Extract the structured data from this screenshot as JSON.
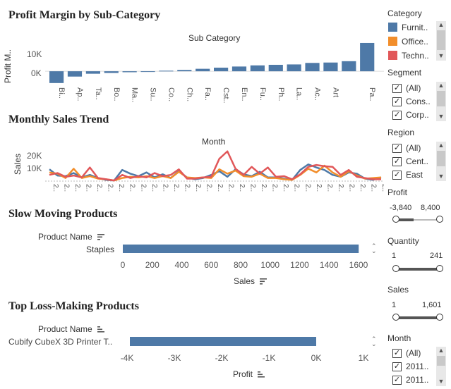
{
  "sections": {
    "profit_margin": {
      "title": "Profit Margin by Sub-Category",
      "header": "Sub Category",
      "y_label": "Profit M..",
      "y_ticks": [
        "10K",
        "0K"
      ]
    },
    "monthly_sales": {
      "title": "Monthly Sales Trend",
      "header": "Month",
      "y_label": "Sales",
      "y_ticks": [
        "20K",
        "10K"
      ]
    },
    "slow_moving": {
      "title": "Slow Moving Products",
      "col_header": "Product Name",
      "row_label": "Staples",
      "x_label": "Sales"
    },
    "loss_making": {
      "title": "Top Loss-Making Products",
      "col_header": "Product Name",
      "row_label": "Cubify CubeX 3D Printer T..",
      "x_label": "Profit"
    }
  },
  "sidebar": {
    "category": {
      "title": "Category",
      "items": [
        {
          "label": "Furnit..",
          "color": "#4e79a7"
        },
        {
          "label": "Office..",
          "color": "#f28e2b"
        },
        {
          "label": "Techn..",
          "color": "#e15759"
        }
      ]
    },
    "segment": {
      "title": "Segment",
      "items": [
        "(All)",
        "Cons..",
        "Corp.."
      ]
    },
    "region": {
      "title": "Region",
      "items": [
        "(All)",
        "Cent..",
        "East"
      ]
    },
    "profit": {
      "title": "Profit",
      "min": "-3,840",
      "max": "8,400"
    },
    "quantity": {
      "title": "Quantity",
      "min": "1",
      "max": "241"
    },
    "sales": {
      "title": "Sales",
      "min": "1",
      "max": "1,601"
    },
    "month": {
      "title": "Month",
      "items": [
        "(All)",
        "2011..",
        "2011.."
      ]
    }
  },
  "colors": {
    "blue": "#4e79a7",
    "orange": "#f28e2b",
    "red": "#e15759"
  },
  "chart_data": [
    {
      "type": "bar",
      "title": "Profit Margin by Sub-Category",
      "xlabel": "Sub Category",
      "ylabel": "Profit M..",
      "categories": [
        "Bi..",
        "Ap..",
        "Ta..",
        "Bo..",
        "Ma..",
        "Su..",
        "Co..",
        "Ch..",
        "Fa..",
        "Cst..",
        "En..",
        "Fu..",
        "Ph..",
        "La..",
        "Ac..",
        "Art",
        "Pa.."
      ],
      "values": [
        -6200,
        -2800,
        -1300,
        -900,
        -500,
        -200,
        300,
        700,
        1300,
        1900,
        2500,
        3100,
        3400,
        3600,
        4400,
        4600,
        5300,
        14900
      ],
      "values_note_categories_extra": [
        "Pa.."
      ],
      "yticks": [
        "10K",
        "0K"
      ],
      "ylim": [
        -7000,
        16000
      ]
    },
    {
      "type": "line",
      "title": "Monthly Sales Trend",
      "xlabel": "Month",
      "ylabel": "Sales",
      "yticks": [
        "20K",
        "10K"
      ],
      "ylim": [
        0,
        25000
      ],
      "series": [
        {
          "color": "#4e79a7",
          "values": [
            9500,
            4500,
            4000,
            6500,
            3000,
            5000,
            2500,
            1000,
            500,
            9000,
            6000,
            4000,
            7000,
            3000,
            5500,
            2500,
            8000,
            3000,
            1500,
            2500,
            5000,
            8000,
            3500,
            9500,
            5500,
            4000,
            7500,
            3000,
            3000,
            2000,
            1000,
            9000,
            13500,
            11000,
            9000,
            5000,
            3500,
            7000,
            6000,
            2000,
            1000,
            3000
          ]
        },
        {
          "color": "#f28e2b",
          "values": [
            7000,
            6000,
            2500,
            10000,
            2500,
            4000,
            2000,
            1500,
            500,
            2500,
            3500,
            3000,
            4000,
            2500,
            4000,
            2500,
            7500,
            3000,
            2500,
            3000,
            2500,
            9500,
            6000,
            8500,
            4000,
            3500,
            6000,
            2500,
            2500,
            1500,
            1000,
            5000,
            10000,
            7000,
            12500,
            7000,
            3500,
            8000,
            4500,
            2000,
            2500,
            3000
          ]
        },
        {
          "color": "#e15759",
          "values": [
            5000,
            6500,
            3500,
            4500,
            3000,
            11000,
            2500,
            1500,
            500,
            5000,
            2500,
            4000,
            3000,
            6500,
            4000,
            5000,
            9500,
            2000,
            2000,
            3000,
            3500,
            18000,
            24000,
            10000,
            5000,
            11500,
            6000,
            11000,
            3500,
            4000,
            1500,
            5500,
            11500,
            13000,
            12000,
            11500,
            5000,
            9000,
            3500,
            2500,
            1500,
            1500
          ]
        }
      ]
    },
    {
      "type": "bar",
      "title": "Slow Moving Products",
      "xlabel": "Sales",
      "categories": [
        "Staples"
      ],
      "values": [
        1601
      ],
      "xticks": [
        "0",
        "200",
        "400",
        "600",
        "800",
        "1000",
        "1200",
        "1400",
        "1600"
      ],
      "xlim": [
        0,
        1600
      ]
    },
    {
      "type": "bar",
      "title": "Top Loss-Making Products",
      "xlabel": "Profit",
      "categories": [
        "Cubify CubeX 3D Printer T.."
      ],
      "values": [
        -4000
      ],
      "xticks": [
        "-4K",
        "-3K",
        "-2K",
        "-1K",
        "0K",
        "1K"
      ],
      "xlim": [
        -4000,
        1000
      ]
    }
  ]
}
